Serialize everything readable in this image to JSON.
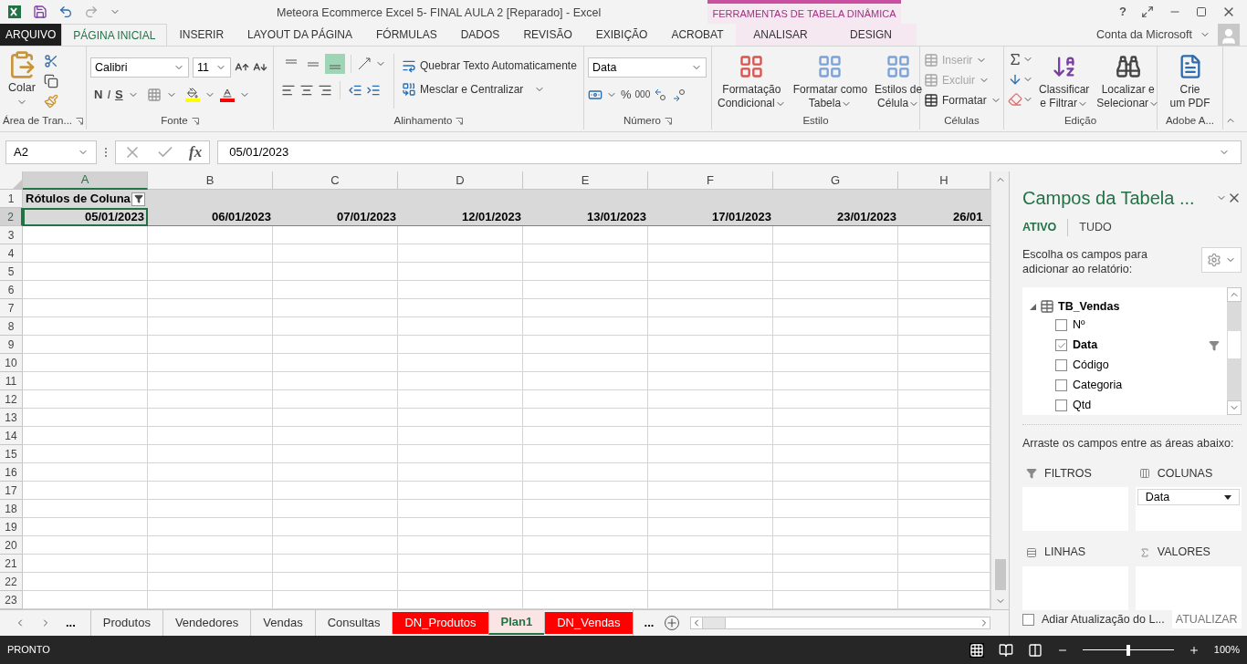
{
  "title_bar": {
    "title": "Meteora Ecommerce Excel 5- FINAL AULA 2 [Reparado] - Excel",
    "contextual_group": "FERRAMENTAS DE TABELA DINÂMICA",
    "help": "?"
  },
  "ribbon_tabs": [
    {
      "label": "ARQUIVO",
      "kind": "file",
      "selected": false
    },
    {
      "label": "PÁGINA INICIAL",
      "kind": "normal",
      "selected": true
    },
    {
      "label": "INSERIR",
      "kind": "normal",
      "selected": false
    },
    {
      "label": "LAYOUT DA PÁGINA",
      "kind": "normal",
      "selected": false
    },
    {
      "label": "FÓRMULAS",
      "kind": "normal",
      "selected": false
    },
    {
      "label": "DADOS",
      "kind": "normal",
      "selected": false
    },
    {
      "label": "REVISÃO",
      "kind": "normal",
      "selected": false
    },
    {
      "label": "EXIBIÇÃO",
      "kind": "normal",
      "selected": false
    },
    {
      "label": "ACROBAT",
      "kind": "normal",
      "selected": false
    },
    {
      "label": "ANALISAR",
      "kind": "contextual",
      "selected": false
    },
    {
      "label": "DESIGN",
      "kind": "contextual",
      "selected": false
    }
  ],
  "account": "Conta da Microsoft",
  "ribbon": {
    "clipboard": {
      "paste": "Colar",
      "label": "Área de Tran..."
    },
    "font": {
      "name": "Calibri",
      "size": "11",
      "bold": "N",
      "italic": "I",
      "underline": "S",
      "label": "Fonte"
    },
    "alignment": {
      "vertical": [
        {
          "selected": false
        },
        {
          "selected": false
        },
        {
          "selected": true
        }
      ],
      "wrap": "Quebrar Texto Automaticamente",
      "merge": "Mesclar e Centralizar",
      "label": "Alinhamento"
    },
    "number": {
      "format": "Data",
      "percent": "%",
      "thousands": "000",
      "label": "Número"
    },
    "styles": {
      "buttons": [
        {
          "line1": "Formatação",
          "line2": "Condicional"
        },
        {
          "line1": "Formatar como",
          "line2": "Tabela"
        },
        {
          "line1": "Estilos de",
          "line2": "Célula"
        }
      ],
      "label": "Estilo"
    },
    "cells": {
      "items": [
        {
          "label": "Inserir",
          "disabled": true
        },
        {
          "label": "Excluir",
          "disabled": true
        },
        {
          "label": "Formatar",
          "disabled": false
        }
      ],
      "label": "Células"
    },
    "editing": {
      "buttons": [
        {
          "line1": "Classificar",
          "line2": "e Filtrar"
        },
        {
          "line1": "Localizar e",
          "line2": "Selecionar"
        }
      ],
      "label": "Edição"
    },
    "adobe": {
      "line1": "Crie",
      "line2": "um PDF",
      "label": "Adobe A..."
    }
  },
  "formula_bar": {
    "name_box": "A2",
    "fx": "fx",
    "formula": "05/01/2023"
  },
  "grid": {
    "columns": [
      {
        "label": "A",
        "selected": true
      },
      {
        "label": "B",
        "selected": false
      },
      {
        "label": "C",
        "selected": false
      },
      {
        "label": "D",
        "selected": false
      },
      {
        "label": "E",
        "selected": false
      },
      {
        "label": "F",
        "selected": false
      },
      {
        "label": "G",
        "selected": false
      },
      {
        "label": "H",
        "selected": false
      }
    ],
    "rows": [
      {
        "label": "1",
        "selected": false,
        "kind": "pivot_header",
        "cells": [
          {
            "text": "Rótulos de Coluna"
          }
        ]
      },
      {
        "label": "2",
        "selected": true,
        "kind": "pivot_values",
        "cells": [
          {
            "text": "05/01/2023",
            "active": true
          },
          {
            "text": "06/01/2023",
            "active": false
          },
          {
            "text": "07/01/2023",
            "active": false
          },
          {
            "text": "12/01/2023",
            "active": false
          },
          {
            "text": "13/01/2023",
            "active": false
          },
          {
            "text": "17/01/2023",
            "active": false
          },
          {
            "text": "23/01/2023",
            "active": false
          },
          {
            "text": "26/01",
            "active": false
          }
        ]
      },
      {
        "label": "3",
        "selected": false,
        "kind": "empty"
      },
      {
        "label": "4",
        "selected": false,
        "kind": "empty"
      },
      {
        "label": "5",
        "selected": false,
        "kind": "empty"
      },
      {
        "label": "6",
        "selected": false,
        "kind": "empty"
      },
      {
        "label": "7",
        "selected": false,
        "kind": "empty"
      },
      {
        "label": "8",
        "selected": false,
        "kind": "empty"
      },
      {
        "label": "9",
        "selected": false,
        "kind": "empty"
      },
      {
        "label": "10",
        "selected": false,
        "kind": "empty"
      },
      {
        "label": "11",
        "selected": false,
        "kind": "empty"
      },
      {
        "label": "12",
        "selected": false,
        "kind": "empty"
      },
      {
        "label": "13",
        "selected": false,
        "kind": "empty"
      },
      {
        "label": "14",
        "selected": false,
        "kind": "empty"
      },
      {
        "label": "15",
        "selected": false,
        "kind": "empty"
      },
      {
        "label": "16",
        "selected": false,
        "kind": "empty"
      },
      {
        "label": "17",
        "selected": false,
        "kind": "empty"
      },
      {
        "label": "18",
        "selected": false,
        "kind": "empty"
      },
      {
        "label": "19",
        "selected": false,
        "kind": "empty"
      },
      {
        "label": "20",
        "selected": false,
        "kind": "empty"
      },
      {
        "label": "21",
        "selected": false,
        "kind": "empty"
      },
      {
        "label": "22",
        "selected": false,
        "kind": "empty"
      },
      {
        "label": "23",
        "selected": false,
        "kind": "empty"
      }
    ]
  },
  "sheet_nav": {
    "more_left": "...",
    "more_right": "..."
  },
  "sheet_tabs": [
    {
      "label": "Produtos",
      "selected": false
    },
    {
      "label": "Vendedores",
      "selected": false
    },
    {
      "label": "Vendas",
      "selected": false
    },
    {
      "label": "Consultas",
      "selected": false
    },
    {
      "label": "DN_Produtos",
      "selected": false,
      "color": "#ff0000"
    },
    {
      "label": "Plan1",
      "selected": true
    },
    {
      "label": "DN_Vendas",
      "selected": false,
      "color": "#ff0000"
    }
  ],
  "pivot_pane": {
    "title": "Campos da Tabela ...",
    "tabs": [
      {
        "label": "ATIVO",
        "selected": true
      },
      {
        "label": "TUDO",
        "selected": false
      }
    ],
    "instruction": "Escolha os campos para adicionar ao relatório:",
    "tables": [
      {
        "label": "TB_Vendas",
        "expanded": true,
        "children": [
          {
            "label": "Nº",
            "checked": false,
            "filtered": false
          },
          {
            "label": "Data",
            "checked": true,
            "filtered": true
          },
          {
            "label": "Código",
            "checked": false,
            "filtered": false
          },
          {
            "label": "Categoria",
            "checked": false,
            "filtered": false
          },
          {
            "label": "Qtd",
            "checked": false,
            "filtered": false
          }
        ]
      }
    ],
    "drag_instruction": "Arraste os campos entre as áreas abaixo:",
    "areas": [
      {
        "label": "FILTROS",
        "kind": "filters"
      },
      {
        "label": "COLUNAS",
        "kind": "columns",
        "fields": [
          "Data"
        ]
      },
      {
        "label": "LINHAS",
        "kind": "rows"
      },
      {
        "label": "VALORES",
        "kind": "values"
      }
    ],
    "defer": {
      "label": "Adiar Atualização do L...",
      "checked": false
    },
    "update_button": "ATUALIZAR"
  },
  "status_bar": {
    "status": "PRONTO",
    "zoom": {
      "level": 0.5,
      "reading": "100%"
    }
  }
}
